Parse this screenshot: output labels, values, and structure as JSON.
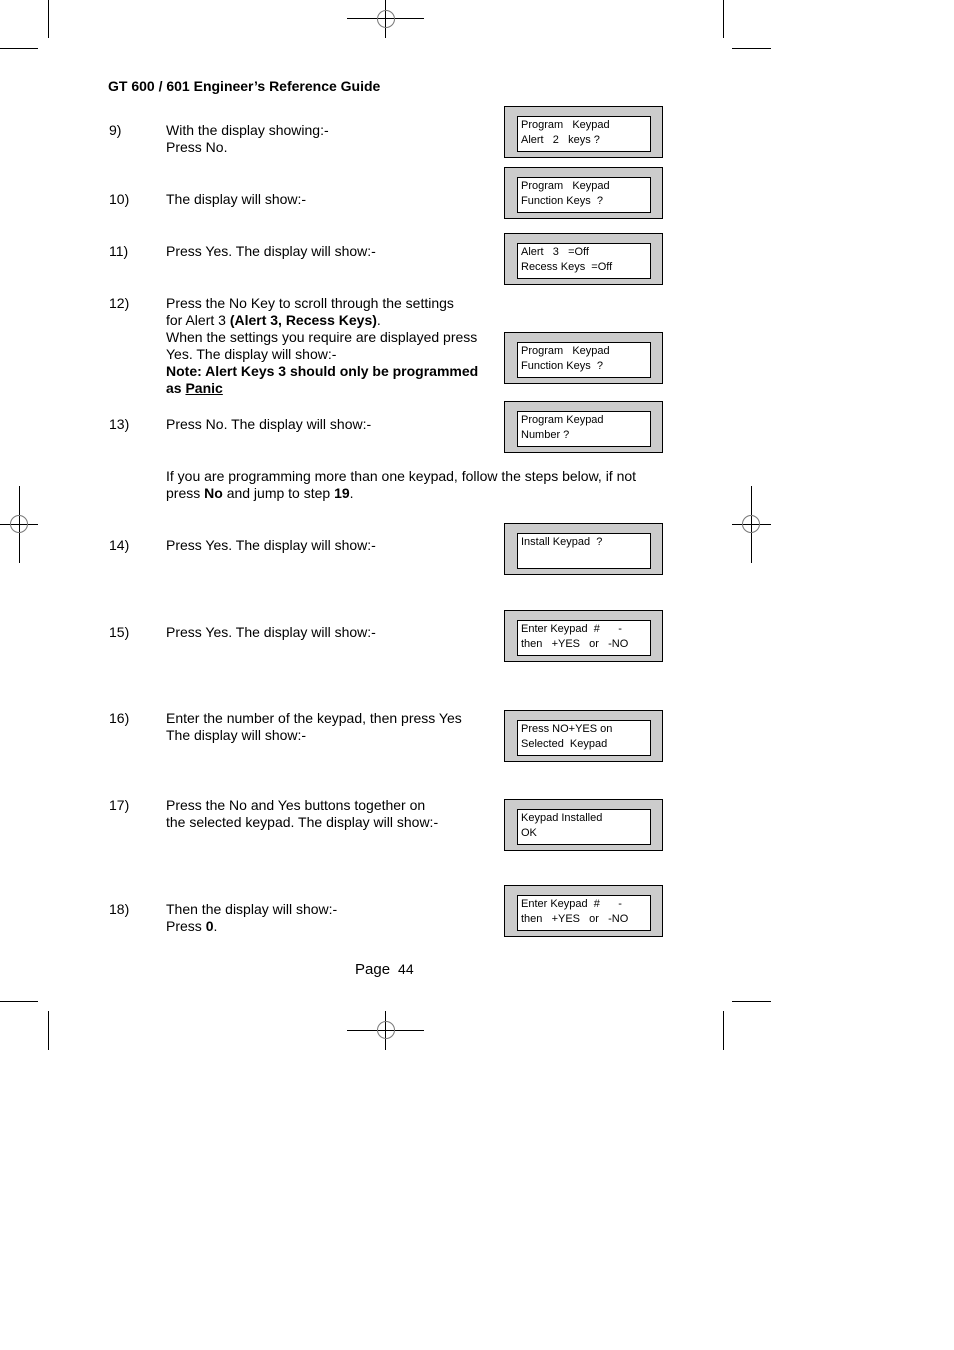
{
  "header": {
    "title": "GT 600 / 601 Engineer’s Reference Guide"
  },
  "steps": [
    {
      "number": "9)",
      "lines": [
        "With the display showing:-",
        "Press No."
      ]
    },
    {
      "number": "10)",
      "lines": [
        "The display will show:-"
      ]
    },
    {
      "number": "11)",
      "lines": [
        "Press Yes. The display will show:-"
      ]
    },
    {
      "number": "12)",
      "lines": [
        "Press the No Key to scroll through the settings",
        "for Alert 3",
        "(Alert 3, Recess Keys)",
        ".",
        "When the settings you require are displayed press",
        "Yes. The display will show:-",
        "Note: Alert Keys 3 should only be programmed",
        "as",
        "Panic"
      ]
    },
    {
      "number": "13)",
      "lines": [
        "Press No. The display will show:-"
      ]
    },
    {
      "number": "",
      "lines": [
        "If you are programming more than one keypad, follow the steps below, if not",
        "press",
        "No",
        "and jump to step",
        "19",
        "."
      ]
    },
    {
      "number": "14)",
      "lines": [
        "Press Yes. The display will show:-"
      ]
    },
    {
      "number": "15)",
      "lines": [
        "Press Yes. The display will show:-"
      ]
    },
    {
      "number": "16)",
      "lines": [
        "Enter the number of the keypad, then press Yes",
        "The display will show:-"
      ]
    },
    {
      "number": "17)",
      "lines": [
        "Press the No and Yes buttons together on",
        "the selected keypad. The display will show:-"
      ]
    },
    {
      "number": "18)",
      "lines": [
        "Then the display will show:-",
        "Press",
        "0",
        "."
      ]
    }
  ],
  "displays": [
    {
      "line1": "Program   Keypad",
      "line2": "Alert   2   keys ?"
    },
    {
      "line1": "Program   Keypad",
      "line2": "Function Keys  ?"
    },
    {
      "line1": "Alert   3   =Off",
      "line2": "Recess Keys  =Off"
    },
    {
      "line1": "Program   Keypad",
      "line2": "Function Keys  ?"
    },
    {
      "line1": "Program Keypad",
      "line2": "Number ?"
    },
    {
      "line1": "Install Keypad  ?",
      "line2": ""
    },
    {
      "line1": "Enter Keypad  #      -",
      "line2": "then   +YES   or   -NO"
    },
    {
      "line1": "Press NO+YES on",
      "line2": "Selected  Keypad"
    },
    {
      "line1": "Keypad Installed",
      "line2": "OK"
    },
    {
      "line1": "Enter Keypad  #      -",
      "line2": "then   +YES   or   -NO"
    }
  ],
  "footer": {
    "page_label": "Page",
    "page_number": "44"
  },
  "colors": {
    "lcd_bezel": "#cccccc",
    "lcd_screen": "#ffffff",
    "text": "#000000"
  }
}
